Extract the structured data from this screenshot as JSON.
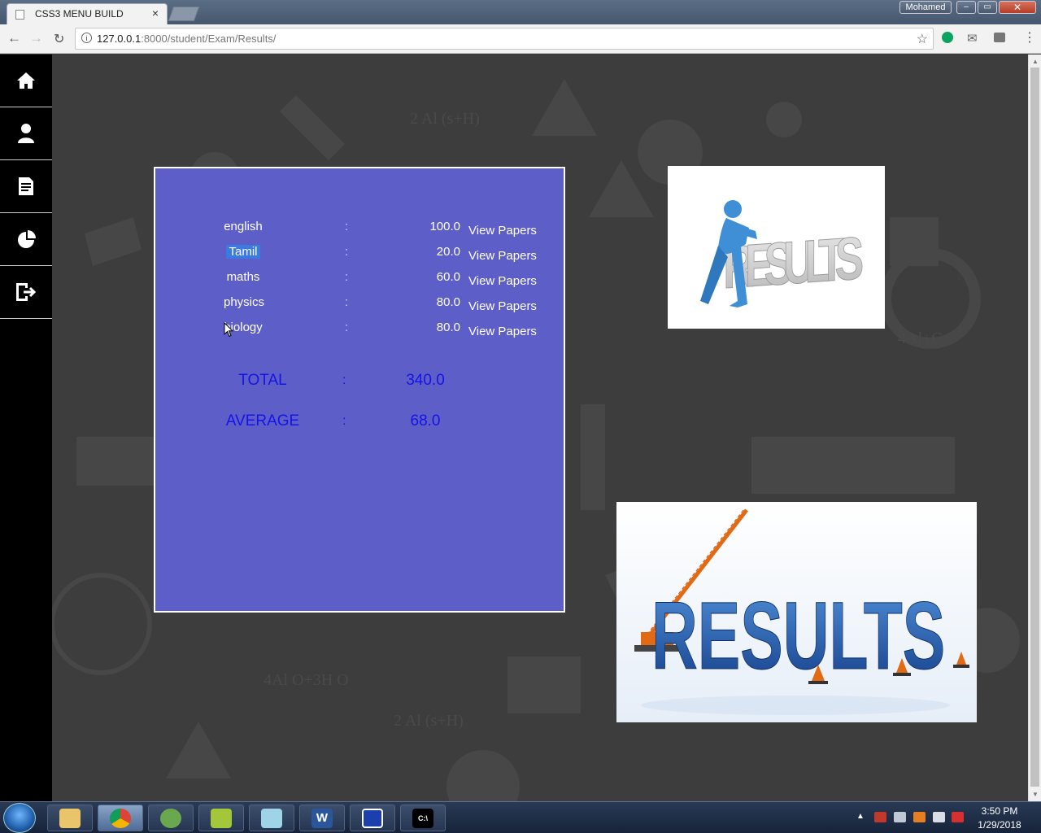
{
  "browser": {
    "tab_title": "CSS3 MENU BUILD",
    "tab_close": "×",
    "user": "Mohamed",
    "window_controls": {
      "minimize": "–",
      "maximize": "▭",
      "close": "✕"
    },
    "url_host": "127.0.0.1",
    "url_path": ":8000/student/Exam/Results/",
    "icons": [
      "back-icon",
      "forward-icon",
      "reload-icon",
      "info-icon",
      "star-icon",
      "extension-icon",
      "mail-icon",
      "menu-icon"
    ]
  },
  "sidebar": {
    "items": [
      {
        "icon": "home-icon"
      },
      {
        "icon": "user-icon"
      },
      {
        "icon": "document-icon"
      },
      {
        "icon": "pie-chart-icon"
      },
      {
        "icon": "logout-icon"
      }
    ]
  },
  "results": {
    "rows": [
      {
        "subject": "english",
        "colon": ":",
        "mark": "100.0",
        "link": "View Papers"
      },
      {
        "subject": "Tamil",
        "colon": ":",
        "mark": "20.0",
        "link": "View Papers"
      },
      {
        "subject": "maths",
        "colon": ":",
        "mark": "60.0",
        "link": "View Papers"
      },
      {
        "subject": "physics",
        "colon": ":",
        "mark": "80.0",
        "link": "View Papers"
      },
      {
        "subject": "biology",
        "colon": ":",
        "mark": "80.0",
        "link": "View Papers"
      }
    ],
    "total": {
      "label": "TOTAL",
      "colon": ":",
      "value": "340.0"
    },
    "average": {
      "label": "AVERAGE",
      "colon": ":",
      "value": "68.0"
    },
    "colors": {
      "panel": "#5e5ec8",
      "summary_text": "#1414e6",
      "highlight": "#3b7be0"
    }
  },
  "images": {
    "image1_text": "RESULTS",
    "image2_text": "RESULTS"
  },
  "taskbar": {
    "apps": [
      "file-explorer-icon",
      "chrome-icon",
      "app-icon",
      "notepad-icon",
      "editor-icon",
      "word-icon",
      "window-icon",
      "terminal-icon"
    ],
    "word_glyph": "W",
    "terminal_glyph": "C:\\",
    "tray_arrow": "▲",
    "time": "3:50 PM",
    "date": "1/29/2018"
  }
}
